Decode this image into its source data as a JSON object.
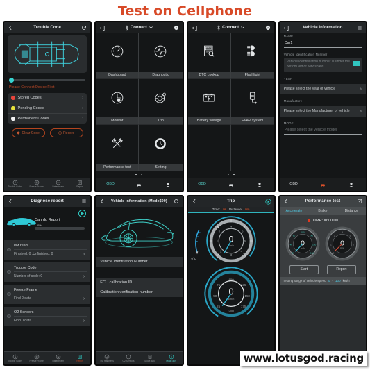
{
  "header": {
    "title": "Test on Cellphone",
    "title_color": "#d84a28"
  },
  "watermark": {
    "text": "www.lotusgod.racing"
  },
  "phone1": {
    "title": "Trouble Code",
    "back_icon": "chevron-left-icon",
    "refresh_icon": "refresh-icon",
    "warning": "Please Connect Device First",
    "codes": [
      {
        "label": "Stored Codes",
        "color": "#e8453c"
      },
      {
        "label": "Pending Codes",
        "color": "#e8e23c"
      },
      {
        "label": "Permanent Codes",
        "color": "#f2f2f2"
      }
    ],
    "buttons": {
      "clear": "Clear Code",
      "record": "Record"
    },
    "tabs": [
      {
        "label": "Trouble Code",
        "icon": "clock-icon",
        "active": false
      },
      {
        "label": "Freeze Frame",
        "icon": "snowflake-icon",
        "active": false
      },
      {
        "label": "Datastream",
        "icon": "gauge-icon",
        "active": false
      },
      {
        "label": "Report",
        "icon": "report-icon",
        "active": false
      }
    ]
  },
  "phone2": {
    "connect_label": "Connect",
    "back_icon": "exit-icon",
    "bluetooth_icon": "bluetooth-icon",
    "chevron_icon": "chevron-down-icon",
    "help_icon": "help-icon",
    "menu": [
      {
        "label": "Dashboard",
        "icon": "dashboard-icon"
      },
      {
        "label": "Diagnostic",
        "icon": "pulse-icon"
      },
      {
        "label": "Monitor",
        "icon": "monitor-icon"
      },
      {
        "label": "Trip",
        "icon": "trip-icon"
      },
      {
        "label": "Performance test",
        "icon": "tools-icon"
      },
      {
        "label": "Setting",
        "icon": "gear-icon"
      }
    ],
    "pager": {
      "pages": 2,
      "active": 0
    },
    "bottom": [
      {
        "label": "OBD",
        "icon": "obd-icon",
        "active": true
      },
      {
        "label": "",
        "icon": "car-icon",
        "active": false
      },
      {
        "label": "",
        "icon": "user-icon",
        "active": false
      }
    ]
  },
  "phone3": {
    "connect_label": "Connect",
    "menu": [
      {
        "label": "DTC Lookup",
        "icon": "dtc-lookup-icon"
      },
      {
        "label": "Flashlight",
        "icon": "flashlight-icon"
      },
      {
        "label": "Battery voltage",
        "icon": "battery-icon"
      },
      {
        "label": "EVAP system",
        "icon": "evap-icon"
      }
    ],
    "pager": {
      "pages": 2,
      "active": 1
    },
    "bottom": [
      {
        "label": "OBD",
        "icon": "obd-icon",
        "active": true
      },
      {
        "label": "",
        "icon": "car-icon",
        "active": false
      },
      {
        "label": "",
        "icon": "user-icon",
        "active": false
      }
    ]
  },
  "phone4": {
    "title": "Vehicle Information",
    "back_icon": "exit-icon",
    "menu_icon": "hamburger-icon",
    "fields": {
      "name_label": "NAME",
      "name_value": "Car1",
      "vin_label": "Vehicle Identification Number",
      "vin_placeholder": "Vehicle identification number is under the bottom left of windshield",
      "year_label": "YEAR",
      "year_value": "Please select the year of vehicle",
      "manufacturer_label": "Manufacture",
      "manufacturer_value": "Please select the Manufacturer of vehicle",
      "model_label": "MODEL",
      "model_placeholder": "Please select the vehicle model"
    },
    "bottom": [
      {
        "label": "OBD",
        "icon": "obd-icon",
        "active": false
      },
      {
        "label": "",
        "icon": "car-icon",
        "active": true
      },
      {
        "label": "",
        "icon": "user-icon",
        "active": false
      }
    ]
  },
  "phone5": {
    "title": "Diagnose report",
    "back_icon": "chevron-left-icon",
    "menu_icon": "hamburger-icon",
    "play_icon": "play-icon",
    "status": "Can do Report",
    "progress": "0%",
    "progress_value": 0,
    "sections": [
      {
        "name": "I/M read",
        "detail": "Finished: 0 ,Unfinished: 0"
      },
      {
        "name": "Trouble Code",
        "detail": "Number of code: 0"
      },
      {
        "name": "Freeze Frame",
        "detail": "Find 0 data"
      },
      {
        "name": "O2 Sensors",
        "detail": "Find 0 data"
      }
    ],
    "tabs": [
      {
        "label": "Trouble Code",
        "icon": "clock-icon",
        "active": false
      },
      {
        "label": "Freeze Frame",
        "icon": "snowflake-icon",
        "active": false
      },
      {
        "label": "Datastream",
        "icon": "gauge-icon",
        "active": false
      },
      {
        "label": "Report",
        "icon": "report-icon",
        "active": true
      }
    ]
  },
  "phone6": {
    "title": "Vehicle Information (Mode$09)",
    "back_icon": "chevron-left-icon",
    "refresh_icon": "refresh-icon",
    "rows": [
      "Vehicle Identifation Number",
      "ECU calibration ID",
      "Calibration verification number"
    ],
    "tabs": [
      {
        "label": "I/M readiness",
        "icon": "check-icon",
        "active": false
      },
      {
        "label": "O2 Sensors",
        "icon": "circle-icon",
        "active": false
      },
      {
        "label": "Mode-$06",
        "icon": "doc-icon",
        "active": false
      },
      {
        "label": "Mode-$09",
        "icon": "info-icon",
        "active": true
      }
    ]
  },
  "phone7": {
    "title": "Trip",
    "back_icon": "chevron-left-icon",
    "play_icon": "play-icon",
    "time_label": "Time:",
    "time_value": "0s",
    "distance_label": "Distance:",
    "distance_value": "0m",
    "gauge_top": {
      "value": "0",
      "unit": "r/min",
      "max": 8
    },
    "gauge_bottom": {
      "value": "0",
      "unit": "km/h",
      "max": 200
    },
    "temp": {
      "value": "0°C"
    }
  },
  "phone8": {
    "title": "Performance test",
    "back_icon": "chevron-left-icon",
    "edit_icon": "edit-icon",
    "tabs": [
      {
        "label": "Accelerate",
        "active": true
      },
      {
        "label": "Brake",
        "active": false
      },
      {
        "label": "Distance",
        "active": false
      }
    ],
    "time": "TIME:00:00:00",
    "gauges": [
      {
        "value": "0",
        "unit": "km/h",
        "needle_color": "#3fc7e0"
      },
      {
        "value": "0",
        "unit": "RPM",
        "needle_color": "#d8503a"
      }
    ],
    "buttons": {
      "start": "Start",
      "report": "Report"
    },
    "range_label": "Testing range of vehicle speed",
    "range_from": "0",
    "range_dash": "-",
    "range_to": "100",
    "range_unit": "km/h"
  }
}
